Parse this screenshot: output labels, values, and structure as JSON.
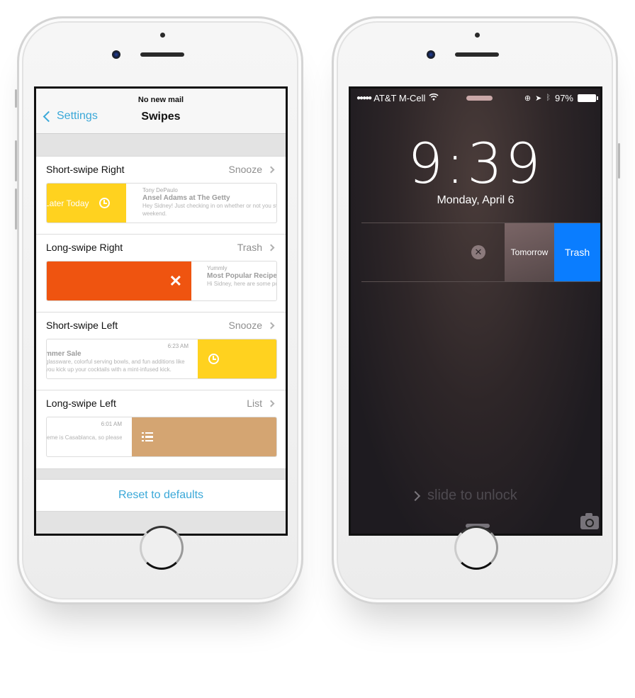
{
  "left_phone": {
    "status_text": "No new mail",
    "nav": {
      "back_label": "Settings",
      "title": "Swipes"
    },
    "rows": [
      {
        "label": "Short-swipe Right",
        "value": "Snooze",
        "action_label": "Later Today",
        "action_icon": "clock-icon",
        "action_color": "#ffd21f",
        "mail": {
          "from": "Tony DePaulo",
          "subject": "Ansel Adams at The Getty",
          "body": "Hey Sidney! Just checking in on whether or not you still w",
          "body2": "weekend."
        }
      },
      {
        "label": "Long-swipe Right",
        "value": "Trash",
        "action_icon": "close-icon",
        "action_color": "#ef5410",
        "mail": {
          "from": "Yummly",
          "subject": "Most Popular Recipes",
          "body": "Hi Sidney, here are some pop"
        }
      },
      {
        "label": "Short-swipe Left",
        "value": "Snooze",
        "action_icon": "clock-icon",
        "action_color": "#ffd21f",
        "mail": {
          "time": "6:23 AM",
          "subject": "mmer Sale",
          "body": "glassware, colorful serving bowls, and fun additions like",
          "body2": "you kick up your cocktails with a mint-infused kick."
        }
      },
      {
        "label": "Long-swipe Left",
        "value": "List",
        "action_icon": "list-icon",
        "action_color": "#d4a572",
        "mail": {
          "time": "6:01 AM",
          "body": "eme is Casablanca, so please"
        }
      }
    ],
    "reset_label": "Reset to defaults",
    "accent_color": "#3aa8d8"
  },
  "right_phone": {
    "status_bar": {
      "signal": "●●●●●",
      "carrier": "AT&T M-Cell",
      "battery": "97%"
    },
    "time": "9:39",
    "date": "Monday, April 6",
    "notification_actions": {
      "tomorrow": "Tomorrow",
      "trash": "Trash"
    },
    "unlock_text": "slide to unlock",
    "trash_color": "#0a7dff"
  }
}
